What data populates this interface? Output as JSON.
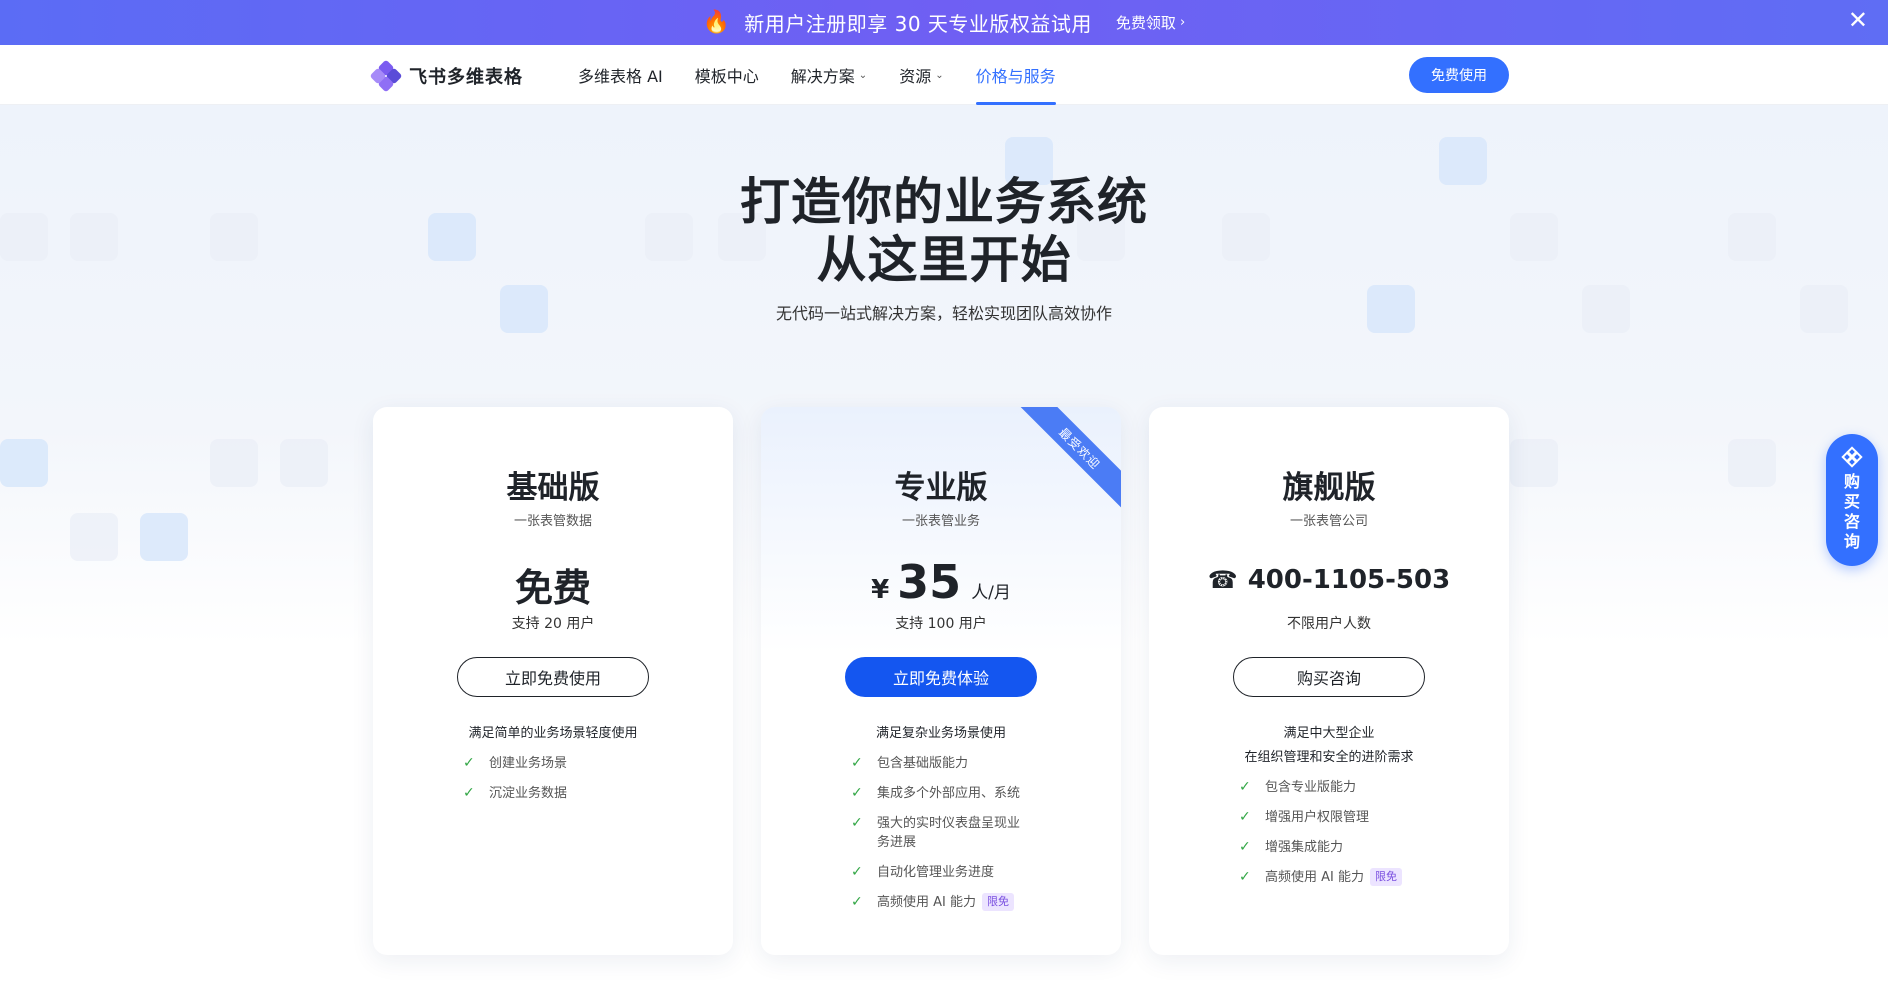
{
  "banner": {
    "icon": "fire-icon",
    "text": "新用户注册即享 30 天专业版权益试用",
    "link_label": "免费领取",
    "bg_color": "#5f6df4"
  },
  "header": {
    "logo_text": "飞书多维表格",
    "nav": [
      {
        "label": "多维表格 AI",
        "dropdown": false
      },
      {
        "label": "模板中心",
        "dropdown": false
      },
      {
        "label": "解决方案",
        "dropdown": true
      },
      {
        "label": "资源",
        "dropdown": true
      },
      {
        "label": "价格与服务",
        "dropdown": false,
        "active": true
      }
    ],
    "cta_label": "免费使用",
    "accent_color": "#3370ff"
  },
  "hero": {
    "title_line1": "打造你的业务系统",
    "title_line2": "从这里开始",
    "subtitle": "无代码一站式解决方案，轻松实现团队高效协作"
  },
  "plans": [
    {
      "name": "基础版",
      "desc": "一张表管数据",
      "price": "免费",
      "users": "支持 20 用户",
      "button": "立即免费使用",
      "feature_head": "满足简单的业务场景轻度使用",
      "features": [
        "创建业务场景",
        "沉淀业务数据"
      ]
    },
    {
      "name": "专业版",
      "desc": "一张表管业务",
      "price_currency": "¥",
      "price_value": "35",
      "price_unit": "人/月",
      "users": "支持 100 用户",
      "button": "立即免费体验",
      "ribbon": "最受欢迎",
      "feature_head": "满足复杂业务场景使用",
      "features": [
        "包含基础版能力",
        "集成多个外部应用、系统",
        "强大的实时仪表盘呈现业务进展",
        "自动化管理业务进度",
        "高频使用 AI 能力"
      ],
      "feature_tag": "限免"
    },
    {
      "name": "旗舰版",
      "desc": "一张表管公司",
      "phone": "400-1105-503",
      "users": "不限用户人数",
      "button": "购买咨询",
      "feature_head_1": "满足中大型企业",
      "feature_head_2": "在组织管理和安全的进阶需求",
      "features": [
        "包含专业版能力",
        "增强用户权限管理",
        "增强集成能力",
        "高频使用 AI 能力"
      ],
      "feature_tag": "限免"
    }
  ],
  "float_button": {
    "label": "购买咨询",
    "icon": "feishu-logo-icon"
  }
}
